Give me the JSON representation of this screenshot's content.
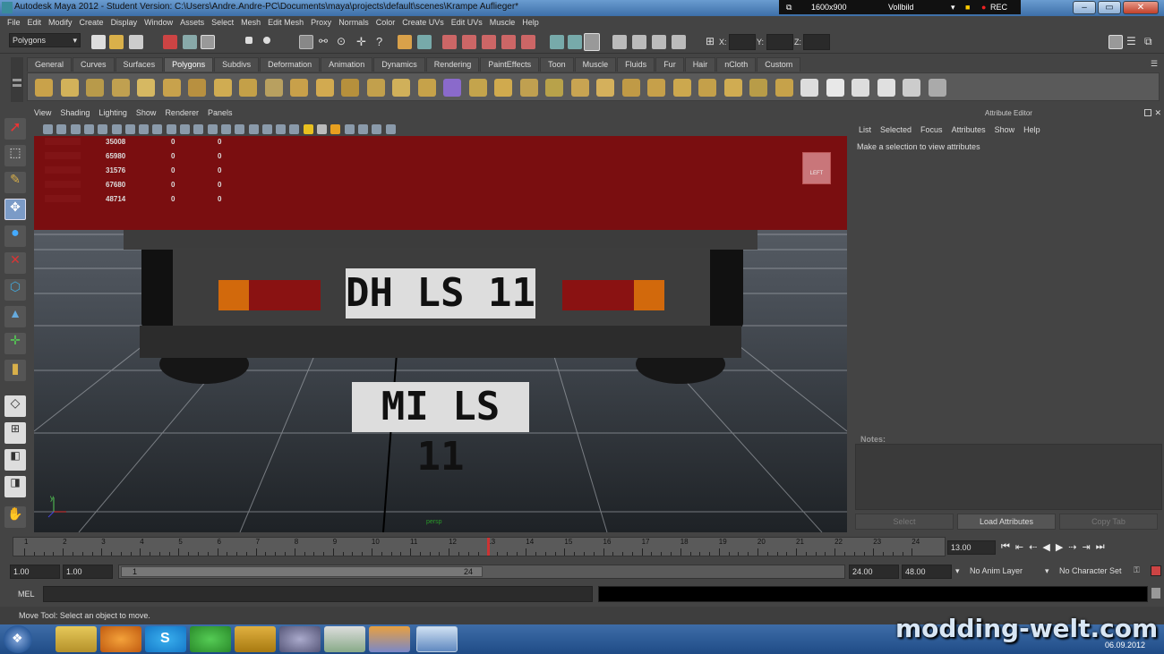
{
  "window": {
    "title": "Autodesk Maya 2012 - Student Version: C:\\Users\\Andre.Andre-PC\\Documents\\maya\\projects\\default\\scenes\\Krampe Auflieger*",
    "resolution": "1600x900",
    "mode": "Vollbild",
    "rec": "REC"
  },
  "menubar": [
    "File",
    "Edit",
    "Modify",
    "Create",
    "Display",
    "Window",
    "Assets",
    "Select",
    "Mesh",
    "Edit Mesh",
    "Proxy",
    "Normals",
    "Color",
    "Create UVs",
    "Edit UVs",
    "Muscle",
    "Help"
  ],
  "statusline": {
    "menuset": "Polygons",
    "x_label": "X:",
    "y_label": "Y:",
    "z_label": "Z:"
  },
  "shelf": {
    "tabs": [
      "General",
      "Curves",
      "Surfaces",
      "Polygons",
      "Subdivs",
      "Deformation",
      "Animation",
      "Dynamics",
      "Rendering",
      "PaintEffects",
      "Toon",
      "Muscle",
      "Fluids",
      "Fur",
      "Hair",
      "nCloth",
      "Custom"
    ],
    "active": "Polygons"
  },
  "panel": {
    "menu": [
      "View",
      "Shading",
      "Lighting",
      "Show",
      "Renderer",
      "Panels"
    ],
    "hud_rows": [
      {
        "v1": "35008",
        "v2": "0",
        "v3": "0"
      },
      {
        "v1": "65980",
        "v2": "0",
        "v3": "0"
      },
      {
        "v1": "31576",
        "v2": "0",
        "v3": "0"
      },
      {
        "v1": "67680",
        "v2": "0",
        "v3": "0"
      },
      {
        "v1": "48714",
        "v2": "0",
        "v3": "0"
      }
    ],
    "viewcube_label": "LEFT",
    "camera_label": "persp",
    "plate_top": "DH LS 11",
    "plate_bottom": "MI LS 11"
  },
  "attribute_editor": {
    "title": "Attribute Editor",
    "menu": [
      "List",
      "Selected",
      "Focus",
      "Attributes",
      "Show",
      "Help"
    ],
    "message": "Make a selection to view attributes",
    "notes_label": "Notes:",
    "buttons": [
      "Select",
      "Load Attributes",
      "Copy Tab"
    ]
  },
  "timeline": {
    "ticks": [
      "1",
      "2",
      "3",
      "4",
      "5",
      "6",
      "7",
      "8",
      "9",
      "10",
      "11",
      "12",
      "13",
      "14",
      "15",
      "16",
      "17",
      "18",
      "19",
      "20",
      "21",
      "22",
      "23",
      "24"
    ],
    "current": "13.00"
  },
  "range": {
    "start": "1.00",
    "start2": "1.00",
    "slider_start": "1",
    "slider_end": "24",
    "end": "24.00",
    "end2": "48.00",
    "anim_layer": "No Anim Layer",
    "char_set": "No Character Set"
  },
  "mel": {
    "label": "MEL"
  },
  "help": {
    "text": "Move Tool: Select an object to move."
  },
  "taskbar": {
    "date": "06.09.2012"
  },
  "watermark": "modding-welt.com",
  "colors": {
    "accent": "#5e84b4",
    "trailer_red": "#7a0e10"
  }
}
